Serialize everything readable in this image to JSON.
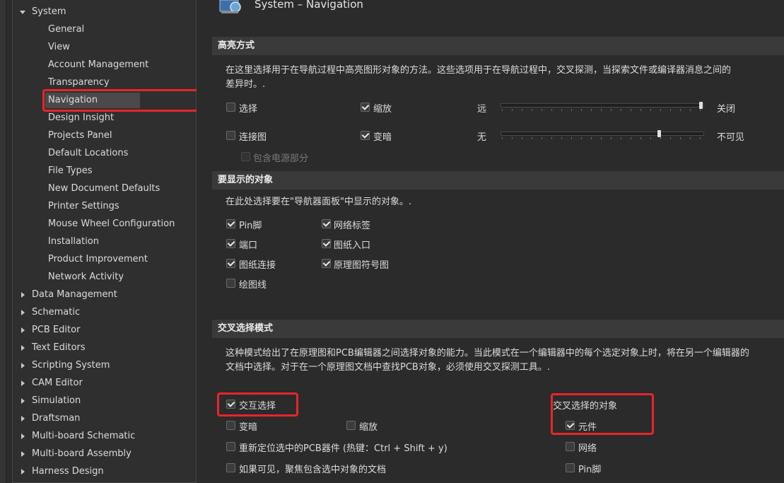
{
  "sidebar": {
    "system_label": "System",
    "system_children": [
      "General",
      "View",
      "Account Management",
      "Transparency",
      "Navigation",
      "Design Insight",
      "Projects Panel",
      "Default Locations",
      "File Types",
      "New Document Defaults",
      "Printer Settings",
      "Mouse Wheel Configuration",
      "Installation",
      "Product Improvement",
      "Network Activity"
    ],
    "top_items": [
      "Data Management",
      "Schematic",
      "PCB Editor",
      "Text Editors",
      "Scripting System",
      "CAM Editor",
      "Simulation",
      "Draftsman",
      "Multi-board Schematic",
      "Multi-board Assembly",
      "Harness Design"
    ],
    "selected": "Navigation"
  },
  "page": {
    "title": "System – Navigation"
  },
  "highlight": {
    "header": "高亮方式",
    "description": "在这里选择用于在导航过程中高亮图形对象的方法。这些选项用于在导航过程中，交叉探测，当探索文件或编译器消息之间的差异时。.",
    "select_label": "选择",
    "zoom_label": "缩放",
    "connect_label": "连接图",
    "dim_label": "变暗",
    "power_label": "包含电源部分",
    "far_label": "远",
    "close_label": "关闭",
    "none_label": "无",
    "invisible_label": "不可见",
    "zoom_slider_value": 1.0,
    "dim_slider_value": 0.79
  },
  "objects": {
    "header": "要显示的对象",
    "description": "在此处选择要在\"导航器面板\"中显示的对象。.",
    "pin": "Pin脚",
    "net_label": "网络标签",
    "port": "端口",
    "sheet_entry": "图纸入口",
    "sheet_connector": "图纸连接",
    "sheet_symbol": "原理图符号图",
    "draw_line": "绘图线"
  },
  "cross": {
    "header": "交叉选择模式",
    "description": "这种模式给出了在原理图和PCB编辑器之间选择对象的能力。当此模式在一个编辑器中的每个选定对象上时，将在另一个编辑器的文档中选择。对于在一个原理图文档中查找PCB对象，必须使用交叉探测工具。.",
    "interactive": "交互选择",
    "dim": "变暗",
    "zoom": "缩放",
    "reposition": "重新定位选中的PCB器件 (热键：Ctrl + Shift + y)",
    "focus": "如果可见，聚焦包含选中对象的文档",
    "objects_label": "交叉选择的对象",
    "component": "元件",
    "net": "网络",
    "pin": "Pin脚"
  },
  "colors": {
    "highlight_box": "#e8252a",
    "background": "#2b2b2b",
    "section_header": "#3a3a3a"
  }
}
